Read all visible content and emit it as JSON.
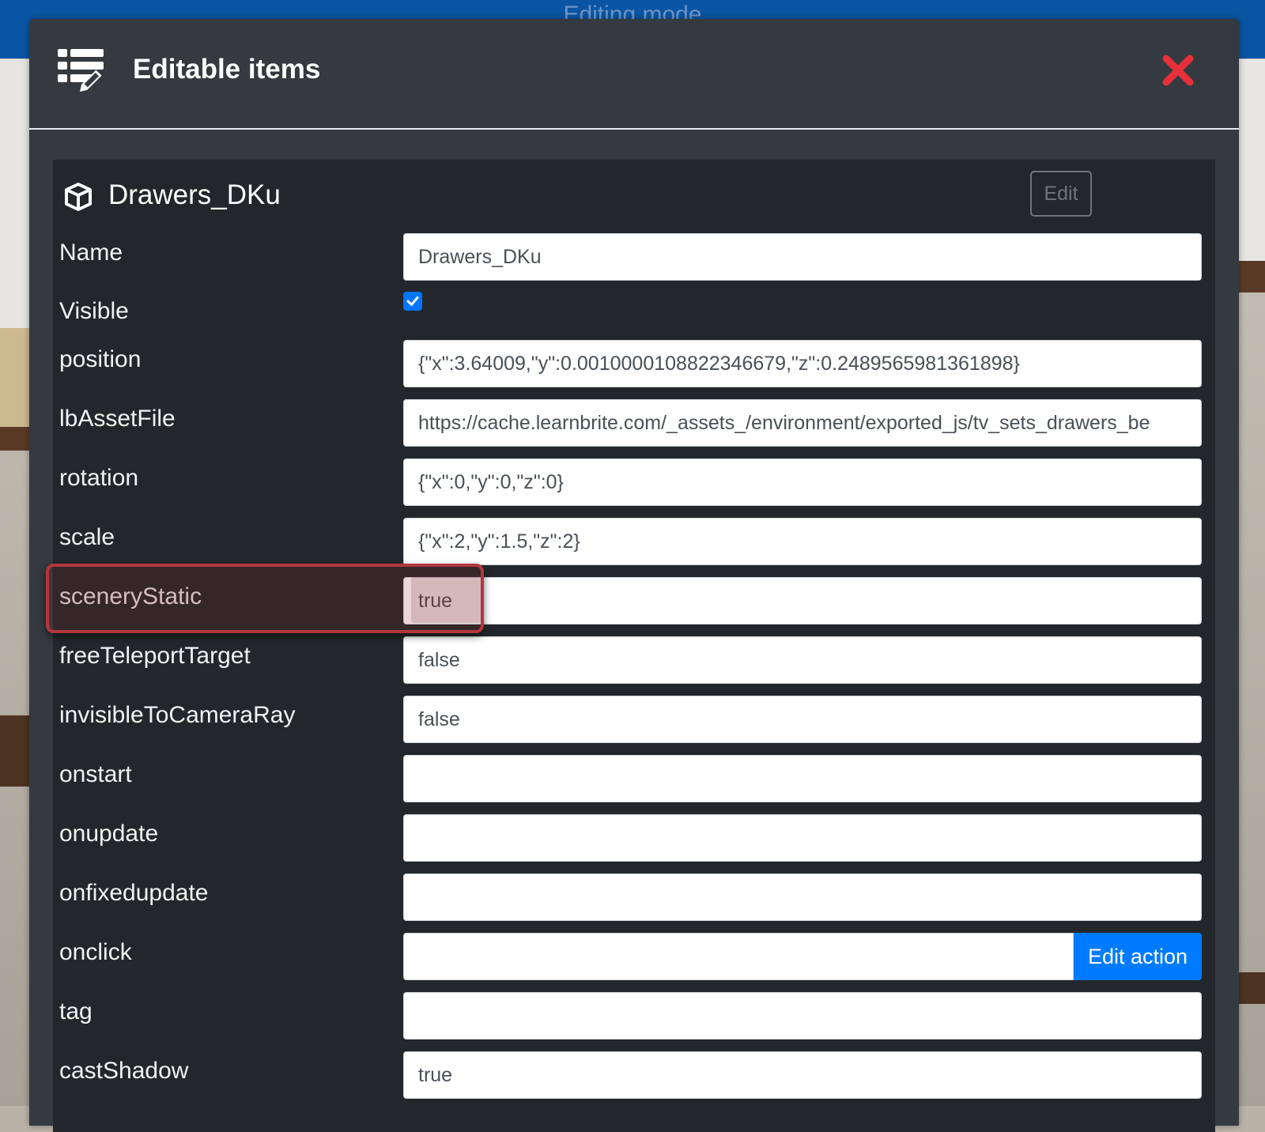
{
  "app": {
    "mode_title": "Editing mode"
  },
  "modal": {
    "title": "Editable items",
    "header_icon": "list-edit-icon",
    "close_icon": "close-icon",
    "close_color": "#e8303a"
  },
  "item": {
    "icon": "cube-icon",
    "name": "Drawers_DKu",
    "edit_label": "Edit",
    "action_button_label": "Edit action",
    "highlighted_field": "sceneryStatic",
    "highlight_color": "#b3363e",
    "fields": [
      {
        "label": "Name",
        "value": ""
      },
      {
        "label": "Visible",
        "checked": true
      },
      {
        "label": "position",
        "value": "{\"x\":3.64009,\"y\":0.0010000108822346679,\"z\":0.2489565981361898}"
      },
      {
        "label": "lbAssetFile",
        "value": "https://cache.learnbrite.com/_assets_/environment/exported_js/tv_sets_drawers_be"
      },
      {
        "label": "rotation",
        "value": "{\"x\":0,\"y\":0,\"z\":0}"
      },
      {
        "label": "scale",
        "value": "{\"x\":2,\"y\":1.5,\"z\":2}"
      },
      {
        "label": "sceneryStatic",
        "value": "true"
      },
      {
        "label": "freeTeleportTarget",
        "value": "false"
      },
      {
        "label": "invisibleToCameraRay",
        "value": "false"
      },
      {
        "label": "onstart",
        "value": ""
      },
      {
        "label": "onupdate",
        "value": ""
      },
      {
        "label": "onfixedupdate",
        "value": ""
      },
      {
        "label": "onclick",
        "value": ""
      },
      {
        "label": "tag",
        "value": ""
      },
      {
        "label": "castShadow",
        "value": "true"
      }
    ]
  }
}
